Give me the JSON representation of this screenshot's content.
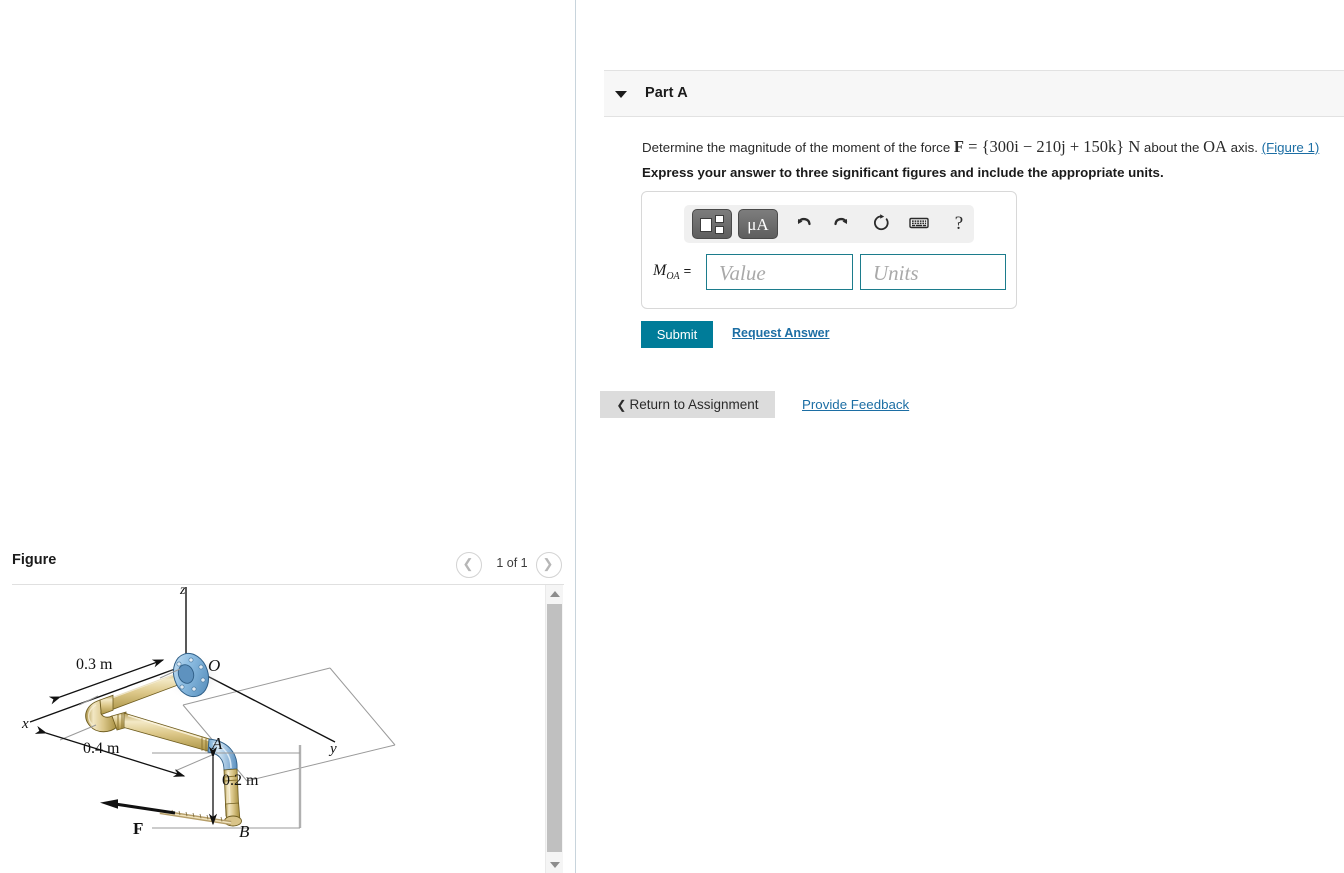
{
  "part": {
    "title": "Part A",
    "toggle_icon": "caret-down-icon",
    "question_prefix": "Determine the magnitude of the moment of the force ",
    "force_symbol": "F",
    "force_equals": " = ",
    "force_value": "{300i  −  210j  +  150k}",
    "force_unit": " N",
    "question_middle": " about the ",
    "axis_symbol": "OA",
    "question_suffix": " axis. ",
    "figure_link": "(Figure 1)",
    "instruction": "Express your answer to three significant figures and include the appropriate units."
  },
  "answer": {
    "label_symbol": "M",
    "label_subscript": "OA",
    "label_equals": "=",
    "value_placeholder": "Value",
    "value_text": "",
    "units_placeholder": "Units",
    "units_text": "",
    "toolbar": {
      "template_button": "math-template-icon",
      "units_button": "μA",
      "undo": "undo-icon",
      "redo": "redo-icon",
      "reset": "reset-icon",
      "keyboard": "keyboard-icon",
      "help": "?"
    }
  },
  "actions": {
    "submit_label": "Submit",
    "request_answer_label": "Request Answer",
    "return_chevron": "❮",
    "return_label": "Return to Assignment",
    "provide_feedback_label": "Provide Feedback"
  },
  "figure": {
    "title": "Figure",
    "pager": {
      "prev_icon": "chevron-left-icon",
      "next_icon": "chevron-right-icon",
      "count_label": "1 of 1"
    },
    "scrollbar": {
      "up_icon": "scroll-up-arrow-icon",
      "down_icon": "scroll-down-arrow-icon"
    },
    "diagram": {
      "axis_x": "x",
      "axis_y": "y",
      "axis_z": "z",
      "point_O": "O",
      "point_A": "A",
      "point_B": "B",
      "force_label": "F",
      "dim_1": "0.3 m",
      "dim_2": "0.4 m",
      "dim_3": "0.2 m",
      "colors": {
        "pipe_body": "#ddc98c",
        "pipe_shade": "#b89c52",
        "pipe_light": "#f1e6c0",
        "flange_blue": "#7fb4dc",
        "elbow_blue": "#9cc6e4",
        "line_black": "#111111",
        "line_gray": "#9a9a9a"
      }
    }
  }
}
